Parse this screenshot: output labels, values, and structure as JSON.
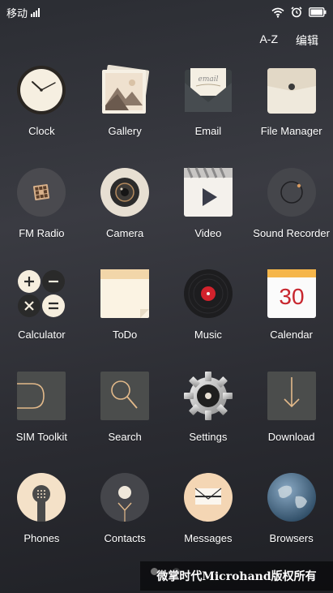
{
  "status_bar": {
    "carrier": "移动"
  },
  "top_actions": {
    "sort": "A-Z",
    "edit": "编辑"
  },
  "apps": [
    {
      "label": "Clock",
      "icon": "clock-icon"
    },
    {
      "label": "Gallery",
      "icon": "gallery-icon"
    },
    {
      "label": "Email",
      "icon": "email-icon"
    },
    {
      "label": "File Manager",
      "icon": "file-manager-icon"
    },
    {
      "label": "FM Radio",
      "icon": "fm-radio-icon"
    },
    {
      "label": "Camera",
      "icon": "camera-icon"
    },
    {
      "label": "Video",
      "icon": "video-icon"
    },
    {
      "label": "Sound Recorder",
      "icon": "sound-recorder-icon"
    },
    {
      "label": "Calculator",
      "icon": "calculator-icon"
    },
    {
      "label": "ToDo",
      "icon": "todo-icon"
    },
    {
      "label": "Music",
      "icon": "music-icon"
    },
    {
      "label": "Calendar",
      "icon": "calendar-icon",
      "badge": "30"
    },
    {
      "label": "SIM Toolkit",
      "icon": "sim-toolkit-icon"
    },
    {
      "label": "Search",
      "icon": "search-icon"
    },
    {
      "label": "Settings",
      "icon": "settings-icon"
    },
    {
      "label": "Download",
      "icon": "download-icon"
    },
    {
      "label": "Phones",
      "icon": "phone-icon"
    },
    {
      "label": "Contacts",
      "icon": "contacts-icon"
    },
    {
      "label": "Messages",
      "icon": "messages-icon"
    },
    {
      "label": "Browsers",
      "icon": "browser-icon"
    }
  ],
  "pager": {
    "page_count": 2,
    "current": 1
  },
  "watermark": "微掌时代Microhand版权所有"
}
